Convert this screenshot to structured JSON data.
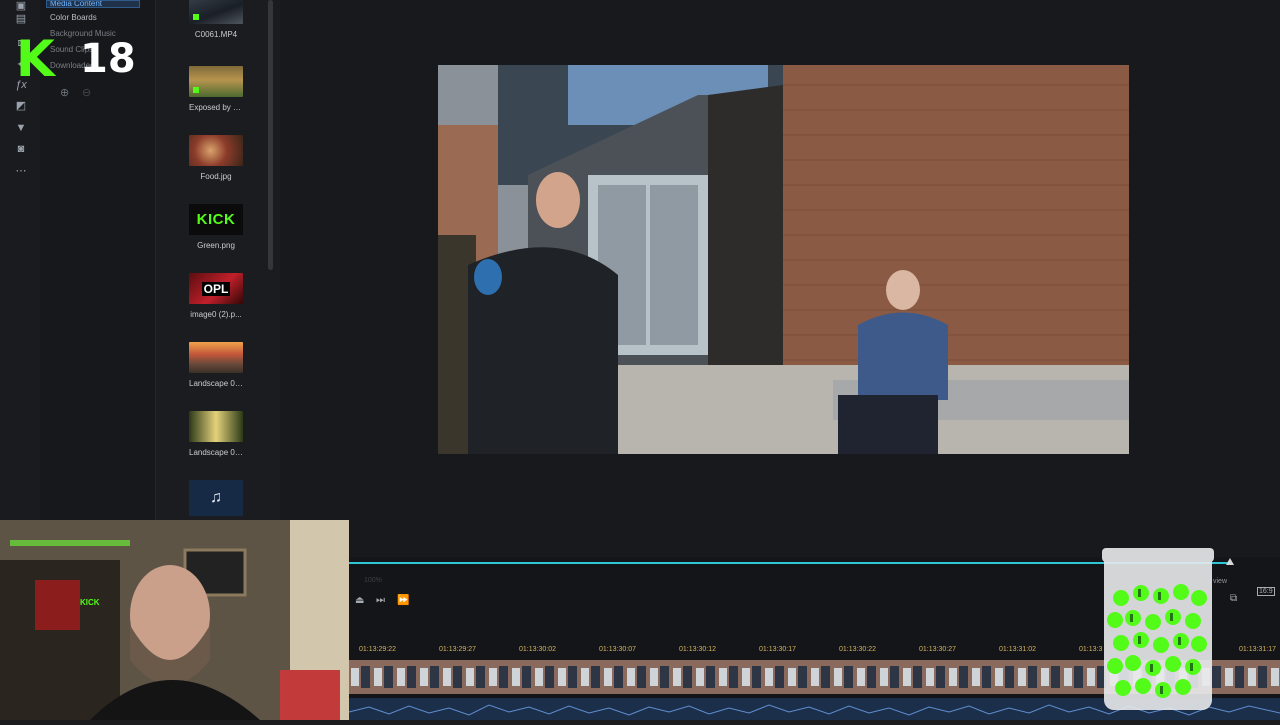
{
  "categories": {
    "items": [
      "Media Content",
      "Color Boards",
      "Background Music",
      "Sound Clips",
      "Downloaded"
    ]
  },
  "media": [
    {
      "name": "C0061.MP4",
      "kind": "video"
    },
    {
      "name": "Exposed by O...",
      "kind": "video"
    },
    {
      "name": "Food.jpg",
      "kind": "image"
    },
    {
      "name": "Green.png",
      "kind": "image",
      "thumb_text": "KICK"
    },
    {
      "name": "image0 (2).p...",
      "kind": "image",
      "thumb_text": "OPL"
    },
    {
      "name": "Landscape 01...",
      "kind": "image"
    },
    {
      "name": "Landscape 02...",
      "kind": "image"
    },
    {
      "name": "",
      "kind": "audio"
    }
  ],
  "overlay": {
    "badge_letter": "K",
    "badge_number": "18",
    "webcam_shirt_text": "KICK"
  },
  "timeline": {
    "zoom": "100%",
    "view_label": "view",
    "aspect": "16:9",
    "timecodes": [
      "01:13:29:22",
      "01:13:29:27",
      "01:13:30:02",
      "01:13:30:07",
      "01:13:30:12",
      "01:13:30:17",
      "01:13:30:22",
      "01:13:30:27",
      "01:13:31:02",
      "01:13:3",
      "01:13:31:17"
    ]
  },
  "colors": {
    "accent": "#2fc6d8",
    "kick_green": "#53fc18",
    "timecode": "#d6b25a"
  }
}
